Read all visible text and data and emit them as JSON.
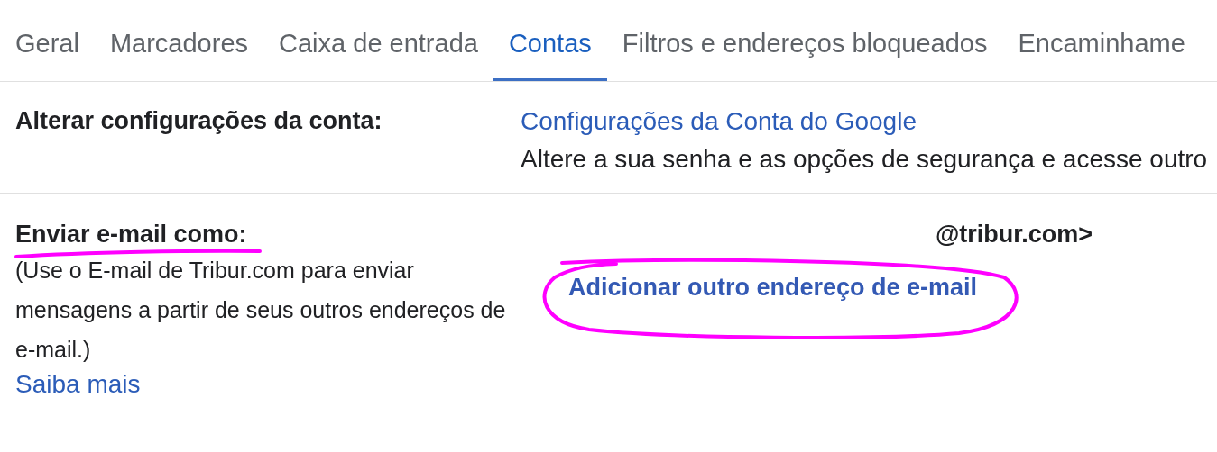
{
  "tabs": [
    {
      "label": "Geral",
      "selected": false
    },
    {
      "label": "Marcadores",
      "selected": false
    },
    {
      "label": "Caixa de entrada",
      "selected": false
    },
    {
      "label": "Contas",
      "selected": true
    },
    {
      "label": "Filtros e endereços bloqueados",
      "selected": false
    },
    {
      "label": "Encaminhame",
      "selected": false
    }
  ],
  "sections": [
    {
      "label": "Alterar configurações da conta:",
      "content": [
        {
          "kind": "link",
          "text": "Configurações da Conta do Google"
        },
        {
          "kind": "text",
          "text": "Altere a sua senha e as opções de segurança e acesse outro"
        }
      ]
    },
    {
      "label": "Enviar e-mail como:",
      "description": "(Use o E-mail de Tribur.com para enviar mensagens a partir de seus outros endereços de e-mail.)",
      "link": "Saiba mais",
      "content": [
        {
          "kind": "address",
          "text": "@tribur.com>"
        },
        {
          "kind": "action",
          "text": "Adicionar outro endereço de e-mail"
        }
      ]
    }
  ],
  "annotations": [
    {
      "kind": "underline",
      "color": "#ff00ff"
    },
    {
      "kind": "ellipse",
      "color": "#ff00ff"
    }
  ]
}
